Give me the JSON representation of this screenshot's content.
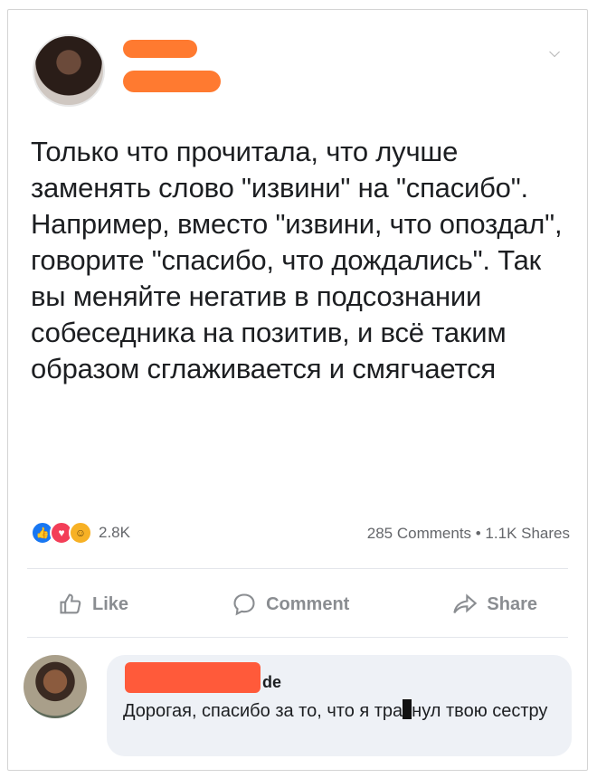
{
  "post": {
    "author_name": "",
    "text": "Только что прочитала, что лучше заменять слово \"извини\" на \"спасибо\". Например, вместо \"извини, что опоздал\", говорите \"спасибо, что дождались\". Так вы меняйте негатив в подсознании собеседника на позитив, и всё таким образом сглаживается и смягчается",
    "reaction_count": "2.8K",
    "stats": "285 Comments • 1.1K Shares"
  },
  "actions": {
    "like": "Like",
    "comment": "Comment",
    "share": "Share"
  },
  "comment": {
    "author_name_suffix": "de",
    "text_before": "Дорогая, спасибо за то, что я тра",
    "text_after": "нул твою сестру"
  },
  "colors": {
    "redaction": "#ff7a30",
    "like_blue": "#1877f2",
    "bubble_bg": "#eef1f6"
  }
}
